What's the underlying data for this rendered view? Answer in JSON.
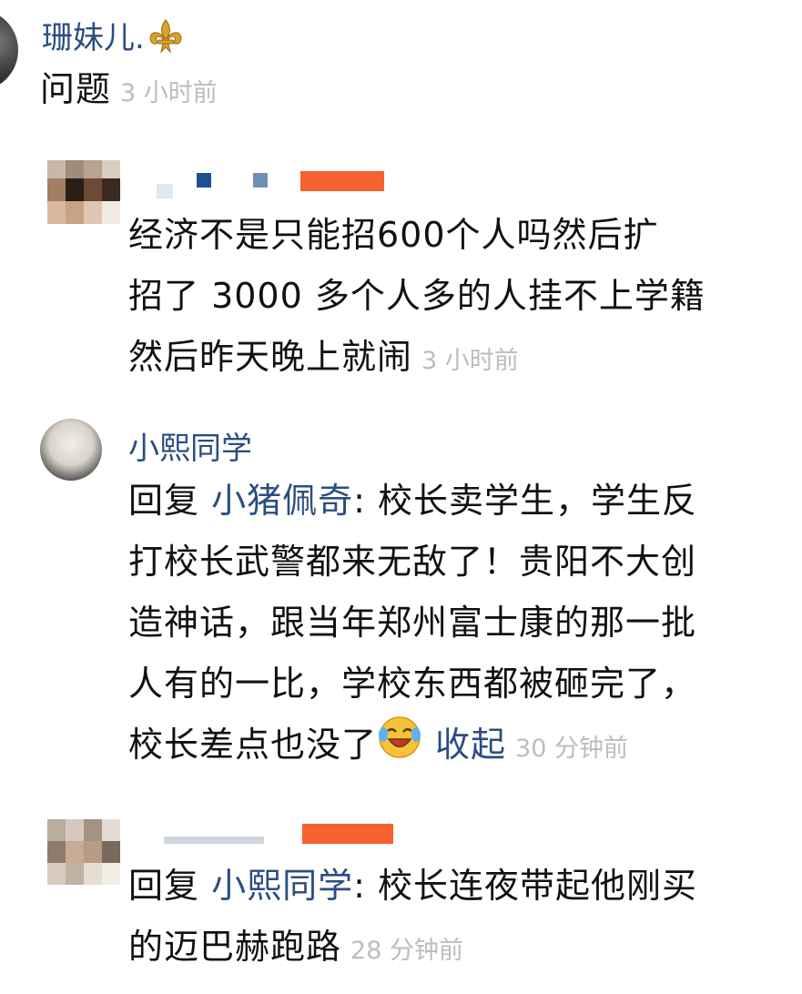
{
  "comments": [
    {
      "username": "珊妹儿.",
      "username_badge": "fleur-de-lis-icon",
      "text": "问题",
      "time": "3 小时前"
    },
    {
      "username": "",
      "text": "经济不是只能招600个人吗然后扩招了 3000 多个人多的人挂不上学籍然后昨天晚上就闹",
      "lines": [
        "经济不是只能招600个人吗然后扩",
        "招了 3000 多个人多的人挂不上学籍",
        "然后昨天晚上就闹"
      ],
      "time": "3 小时前"
    },
    {
      "username": "小熙同学",
      "reply_prefix": "回复",
      "reply_to": "小猪佩奇",
      "lines": [
        "校长卖学生，学生反",
        "打校长武警都来无敌了！贵阳不大创",
        "造神话，跟当年郑州富士康的那一批",
        "人有的一比，学校东西都被砸完了，",
        "校长差点也没了"
      ],
      "emoji": "laughing-crying-emoji-icon",
      "collapse_label": "收起",
      "time": "30 分钟前"
    },
    {
      "username": "",
      "reply_prefix": "回复",
      "reply_to": "小熙同学",
      "lines": [
        "校长连夜带起他刚买",
        "的迈巴赫跑路"
      ],
      "time": "28 分钟前"
    }
  ],
  "colors": {
    "username": "#2a4e80",
    "time": "#bdbdbd",
    "text": "#111111",
    "redaction": "#f4622f"
  }
}
